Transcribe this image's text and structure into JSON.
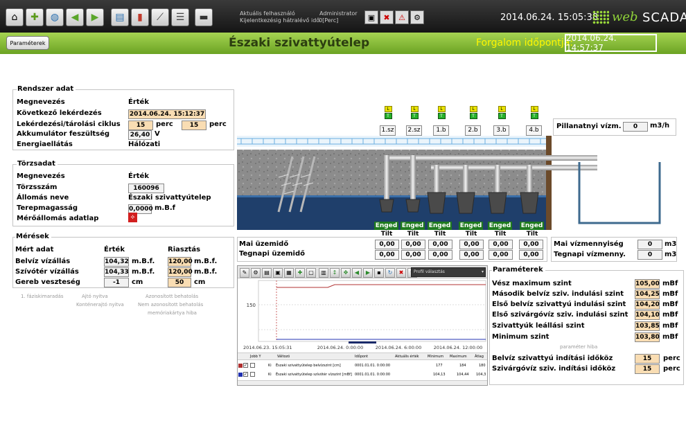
{
  "toolbar": {
    "icons": [
      "home-icon",
      "puzzle-icon",
      "globe-icon",
      "back-icon",
      "forward-icon",
      "export-icon",
      "pdf-icon",
      "trend-icon",
      "database-icon",
      "router-icon"
    ]
  },
  "header_info": {
    "user_label": "Aktuális felhasználó",
    "user_value": "Administrator",
    "session_label": "Kijelentkezésig hátralévő idő",
    "session_value": "0[Perc]"
  },
  "clock": "2014.06.24. 15:05:38",
  "logo": {
    "w": "web",
    "s": "SCADA"
  },
  "params_button": "Paraméterek",
  "page_title": "Északi szivattyútelep",
  "traffic": {
    "label": "Forgalom időpontja:",
    "value": "2014.06.24. 14:57:37"
  },
  "system": {
    "title": "Rendszer adat",
    "col_name": "Megnevezés",
    "col_value": "Érték",
    "next_query_label": "Következő lekérdezés",
    "next_query": "2014.06.24. 15:12:37",
    "cycle_label": "Lekérdezési/tárolási ciklus",
    "cycle1": "15",
    "cycle2": "15",
    "unit_perc": "perc",
    "battery_label": "Akkumulátor feszültség",
    "battery": "26,40",
    "battery_unit": "V",
    "power_label": "Energiaellátás",
    "power": "Hálózati"
  },
  "master": {
    "title": "Törzsadat",
    "col_name": "Megnevezés",
    "col_value": "Érték",
    "serial_label": "Törzsszám",
    "serial": "160096",
    "station_label": "Állomás neve",
    "station": "Északi szivattyútelep",
    "elev_label": "Terepmagasság",
    "elev": "0,0000",
    "elev_unit": "m.B.f",
    "sheet_label": "Mérőállomás adatlap"
  },
  "meas": {
    "title": "Mérések",
    "col_name": "Mért adat",
    "col_value": "Érték",
    "col_alarm": "Riasztás",
    "rows": [
      {
        "label": "Belvíz vízállás",
        "value": "104,32",
        "unit": "m.B.f.",
        "alarm": "120,00",
        "aunit": "m.B.f."
      },
      {
        "label": "Szívótér vízállás",
        "value": "104,33",
        "unit": "m.B.f.",
        "alarm": "120,00",
        "aunit": "m.B.f."
      },
      {
        "label": "Gereb veszteség",
        "value": "-1",
        "unit": "cm",
        "alarm": "50",
        "aunit": "cm"
      }
    ]
  },
  "alarms": {
    "phase": "1. fáziskimaradás",
    "door": "Ajtó nyitva",
    "intrude1": "Azonosított behatolás",
    "container": "Konténerajtó nyitva",
    "intrude2": "Nem azonosított behatolás",
    "memcard": "memóriakártya hiba"
  },
  "pumps": {
    "ids": [
      "1.sz",
      "2.sz",
      "1.b",
      "2.b",
      "3.b",
      "4.b"
    ],
    "engaged": "Enged",
    "blocked": "Tilt",
    "lt": "L",
    "gt": "T",
    "today_label": "Mai üzemidő",
    "yesterday_label": "Tegnapi üzemidő",
    "today": [
      "0,00",
      "0,00",
      "0,00",
      "0,00",
      "0,00",
      "0,00"
    ],
    "yesterday": [
      "0,00",
      "0,00",
      "0,00",
      "0,00",
      "0,00",
      "0,00"
    ]
  },
  "flow": {
    "label": "Pillanatnyi vízm.",
    "value": "0",
    "unit": "m3/h"
  },
  "water": {
    "today_label": "Mai vízmennyiség",
    "today": "0",
    "yesterday_label": "Tegnapi vízmenny.",
    "yesterday": "0",
    "unit": "m3"
  },
  "chart_data": {
    "type": "line",
    "x_ticks": [
      "2014.06.23. 15:05:31",
      "2014.06.24. 0:00:00",
      "2014.06.24. 6:00:00",
      "2014.06.24. 12:00:00"
    ],
    "y_ticks": [
      "150"
    ],
    "profile_label": "Profil választás",
    "series": [
      {
        "name": "Északi szivattyútelep belvízszint [cm]"
      },
      {
        "name": "Északi szivattyútelep szívótér vízszint [mBf]"
      }
    ],
    "table": {
      "headers": [
        "Jobb Y",
        "",
        "Változó",
        "Időpont",
        "Aktuális érték",
        "Minimum",
        "Maximum",
        "Átlag"
      ],
      "rows": [
        {
          "flag": "Ki",
          "name": "Északi szivattyútelep belvízszint [cm]",
          "time": "0001.01.01. 0:00:00",
          "current": "",
          "min": "177",
          "max": "184",
          "avg": "180"
        },
        {
          "flag": "Ki",
          "name": "Északi szivattyútelep szívótér vízszint [mBf]",
          "time": "0001.01.01. 0:00:00",
          "current": "",
          "min": "104,13",
          "max": "104,44",
          "avg": "104,3"
        }
      ]
    }
  },
  "params": {
    "title": "Paraméterek",
    "rows": [
      {
        "label": "Vész maximum szint",
        "value": "105,00",
        "unit": "mBf"
      },
      {
        "label": "Második belvíz sziv. indulási szint",
        "value": "104,25",
        "unit": "mBf"
      },
      {
        "label": "Első belvíz szivattyú indulási szint",
        "value": "104,20",
        "unit": "mBf"
      },
      {
        "label": "Első szivárgóvíz sziv. indulási szint",
        "value": "104,10",
        "unit": "mBf"
      },
      {
        "label": "Szivattyúk leállási szint",
        "value": "103,85",
        "unit": "mBf"
      },
      {
        "label": "Minimum szint",
        "value": "103,80",
        "unit": "mBf"
      }
    ],
    "error": "paraméter hiba",
    "int1_label": "Belvíz szivattyú indítási időköz",
    "int1": "15",
    "int2_label": "Szivárgóvíz sziv. indítási időköz",
    "int2": "15",
    "int_unit": "perc"
  }
}
